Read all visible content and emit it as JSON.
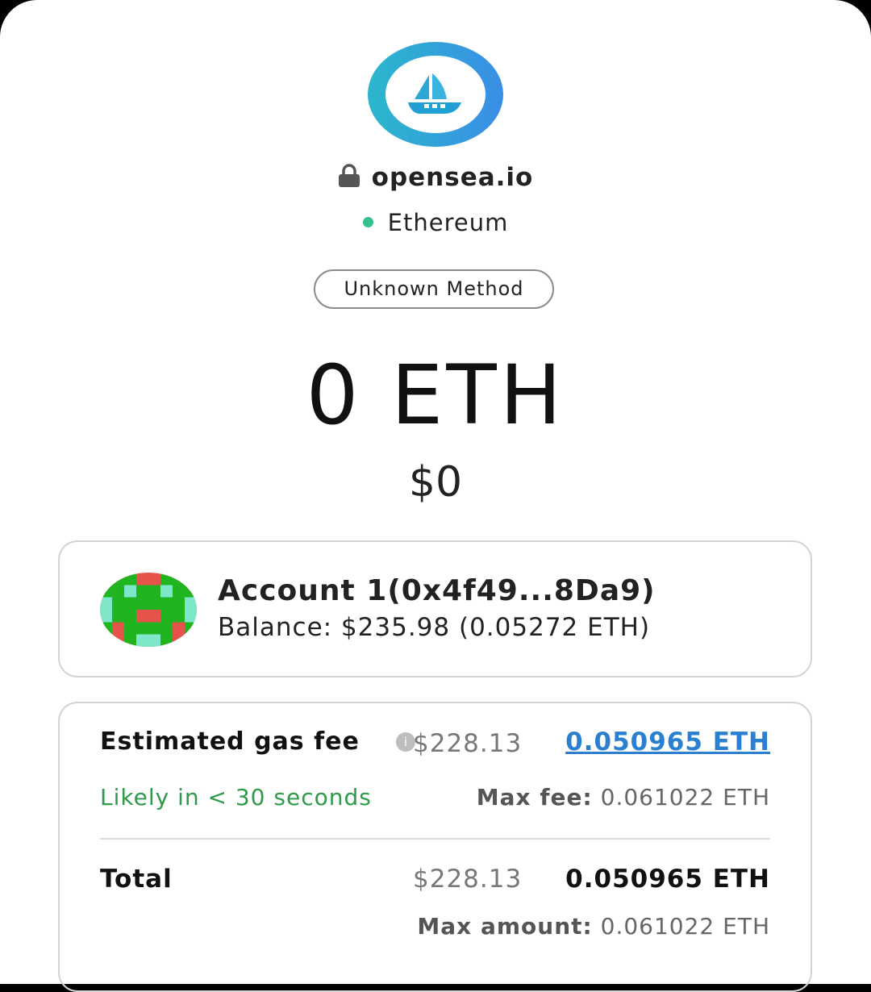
{
  "site": {
    "domain": "opensea.io",
    "lock_icon": "lock-icon",
    "logo_icon": "opensea-ship-icon"
  },
  "network": {
    "name": "Ethereum",
    "status_color": "#36c08a"
  },
  "method_label": "Unknown Method",
  "transaction": {
    "amount": "0 ETH",
    "fiat": "$0"
  },
  "account": {
    "name": "Account 1(0x4f49...8Da9)",
    "balance": "Balance: $235.98 (0.05272 ETH)",
    "avatar_icon": "identicon-avatar"
  },
  "gas": {
    "label": "Estimated gas fee",
    "info_icon": "info-icon",
    "usd": "$228.13",
    "eth": "0.050965 ETH",
    "eth_color": "#2a7fd0",
    "likely": "Likely in < 30 seconds",
    "likely_color": "#2e9a4a",
    "max_fee_label": "Max fee:",
    "max_fee_value": "0.061022 ETH"
  },
  "total": {
    "label": "Total",
    "usd": "$228.13",
    "eth": "0.050965 ETH",
    "max_amount_label": "Max amount:",
    "max_amount_value": "0.061022 ETH"
  }
}
